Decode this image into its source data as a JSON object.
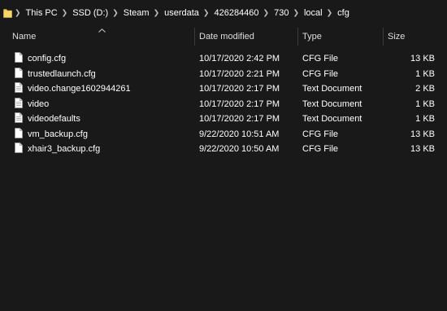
{
  "breadcrumb": [
    "This PC",
    "SSD (D:)",
    "Steam",
    "userdata",
    "426284460",
    "730",
    "local",
    "cfg"
  ],
  "columns": {
    "name": "Name",
    "date": "Date modified",
    "type": "Type",
    "size": "Size"
  },
  "sort_indicator": "sort-ascending-arrow",
  "files": [
    {
      "name": "config.cfg",
      "date": "10/17/2020 2:42 PM",
      "type": "CFG File",
      "size": "13 KB",
      "icon": "file-icon"
    },
    {
      "name": "trustedlaunch.cfg",
      "date": "10/17/2020 2:21 PM",
      "type": "CFG File",
      "size": "1 KB",
      "icon": "file-icon"
    },
    {
      "name": "video.change1602944261",
      "date": "10/17/2020 2:17 PM",
      "type": "Text Document",
      "size": "2 KB",
      "icon": "text-document-icon"
    },
    {
      "name": "video",
      "date": "10/17/2020 2:17 PM",
      "type": "Text Document",
      "size": "1 KB",
      "icon": "text-document-icon"
    },
    {
      "name": "videodefaults",
      "date": "10/17/2020 2:17 PM",
      "type": "Text Document",
      "size": "1 KB",
      "icon": "text-document-icon"
    },
    {
      "name": "vm_backup.cfg",
      "date": "9/22/2020 10:51 AM",
      "type": "CFG File",
      "size": "13 KB",
      "icon": "file-icon"
    },
    {
      "name": "xhair3_backup.cfg",
      "date": "9/22/2020 10:50 AM",
      "type": "CFG File",
      "size": "13 KB",
      "icon": "file-icon"
    }
  ],
  "colors": {
    "background": "#191919",
    "text": "#ffffff",
    "header_text": "#dedede",
    "divider": "#3b3b3b",
    "folder_yellow": "#f3c74f"
  }
}
